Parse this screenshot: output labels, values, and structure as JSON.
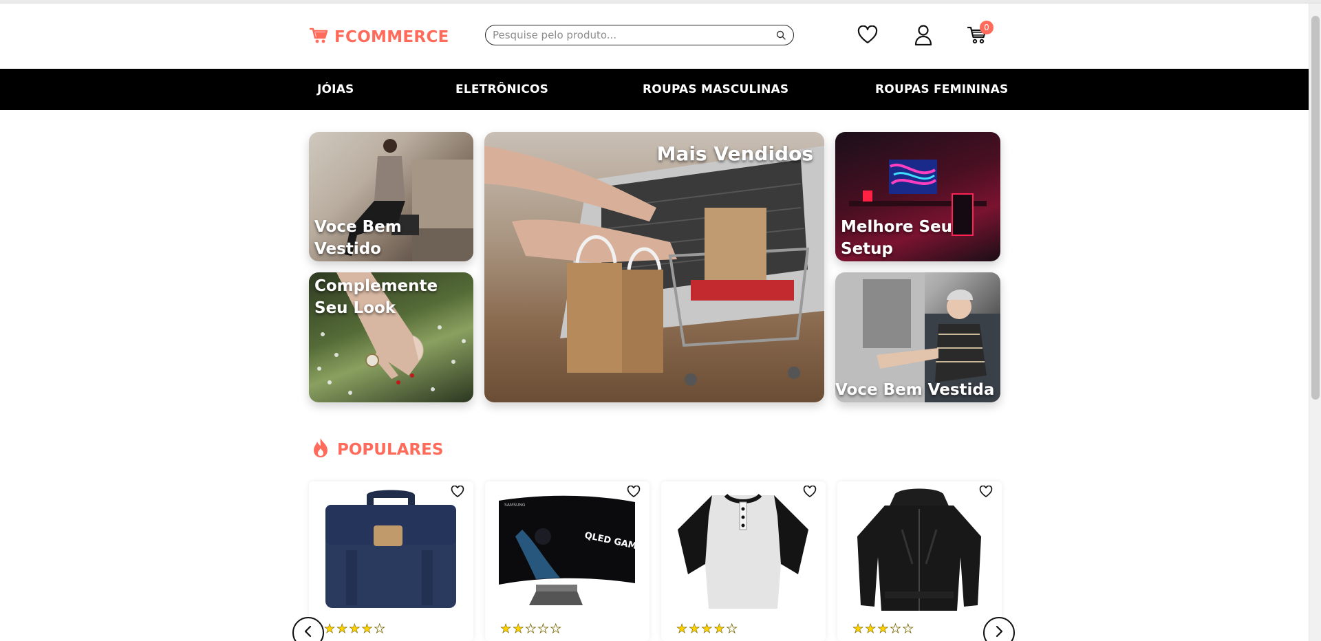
{
  "brand": {
    "name": "FCOMMERCE",
    "accent_color": "#ff6b5b",
    "logo_icon": "cart-icon"
  },
  "search": {
    "placeholder": "Pesquise pelo produto...",
    "value": "",
    "icon": "search-icon"
  },
  "header_icons": {
    "wishlist": "heart-icon",
    "account": "user-icon",
    "cart": "cart-icon",
    "cart_count": "0"
  },
  "nav": {
    "items": [
      {
        "label": "JÓIAS"
      },
      {
        "label": "ELETRÔNICOS"
      },
      {
        "label": "ROUPAS MASCULINAS"
      },
      {
        "label": "ROUPAS FEMININAS"
      }
    ]
  },
  "banners": [
    {
      "label": "Voce Bem Vestido"
    },
    {
      "label": "Complemente Seu Look"
    },
    {
      "label": "Mais Vendidos"
    },
    {
      "label": "Melhore Seu Setup"
    },
    {
      "label": "Voce Bem Vestida"
    }
  ],
  "popular": {
    "title": "POPULARES",
    "icon": "fire-icon",
    "products": [
      {
        "item": "backpack",
        "rating": 4,
        "rating_max": 5
      },
      {
        "item": "monitor",
        "rating": 2,
        "rating_max": 5
      },
      {
        "item": "t-shirt",
        "rating": 4,
        "rating_max": 5
      },
      {
        "item": "jacket",
        "rating": 3,
        "rating_max": 5
      }
    ],
    "prev_icon": "chevron-left-icon",
    "next_icon": "chevron-right-icon",
    "monitor_screen_text": "QLED GAMING MONITOR",
    "monitor_brand": "SAMSUNG"
  }
}
